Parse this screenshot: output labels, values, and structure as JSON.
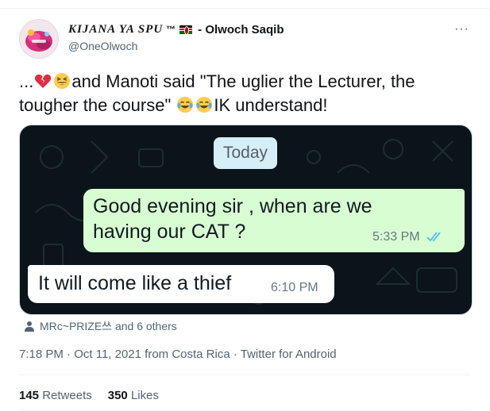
{
  "author": {
    "display_name": "KIJANA YA SPU",
    "trademark": "™",
    "name_suffix": "- Olwoch Saqib",
    "handle": "@OneOlwoch",
    "flag_icon": "kenya-flag-icon"
  },
  "more_label": "···",
  "tweet": {
    "part1": "...",
    "part2": "and Manoti said \"The uglier the Lecturer, the tougher the course\"",
    "part3": "IK understand!",
    "emojis": [
      "broken-heart-icon",
      "grinning-squinting-face-icon",
      "face-with-tears-of-joy-icon",
      "face-with-tears-of-joy-icon"
    ]
  },
  "chat": {
    "date_chip": "Today",
    "outgoing": {
      "text": "Good evening sir , when are we having our CAT ?",
      "time": "5:33 PM",
      "status_icon": "double-check-icon",
      "status_color": "#53bdeb"
    },
    "incoming": {
      "text": "It will come like a thief",
      "time": "6:10 PM"
    },
    "colors": {
      "background": "#0b141a",
      "outgoing_bubble": "#d9fdd3",
      "incoming_bubble": "#ffffff",
      "date_chip": "#d6eef7"
    }
  },
  "tagged": {
    "text": "MRc~PRIZE쓰 and 6 others"
  },
  "meta": {
    "time": "7:18 PM",
    "sep1": " · ",
    "date": "Oct 11, 2021 from Costa Rica",
    "sep2": " · ",
    "source": "Twitter for Android"
  },
  "stats": {
    "retweets_count": "145",
    "retweets_label": "Retweets",
    "likes_count": "350",
    "likes_label": "Likes"
  }
}
